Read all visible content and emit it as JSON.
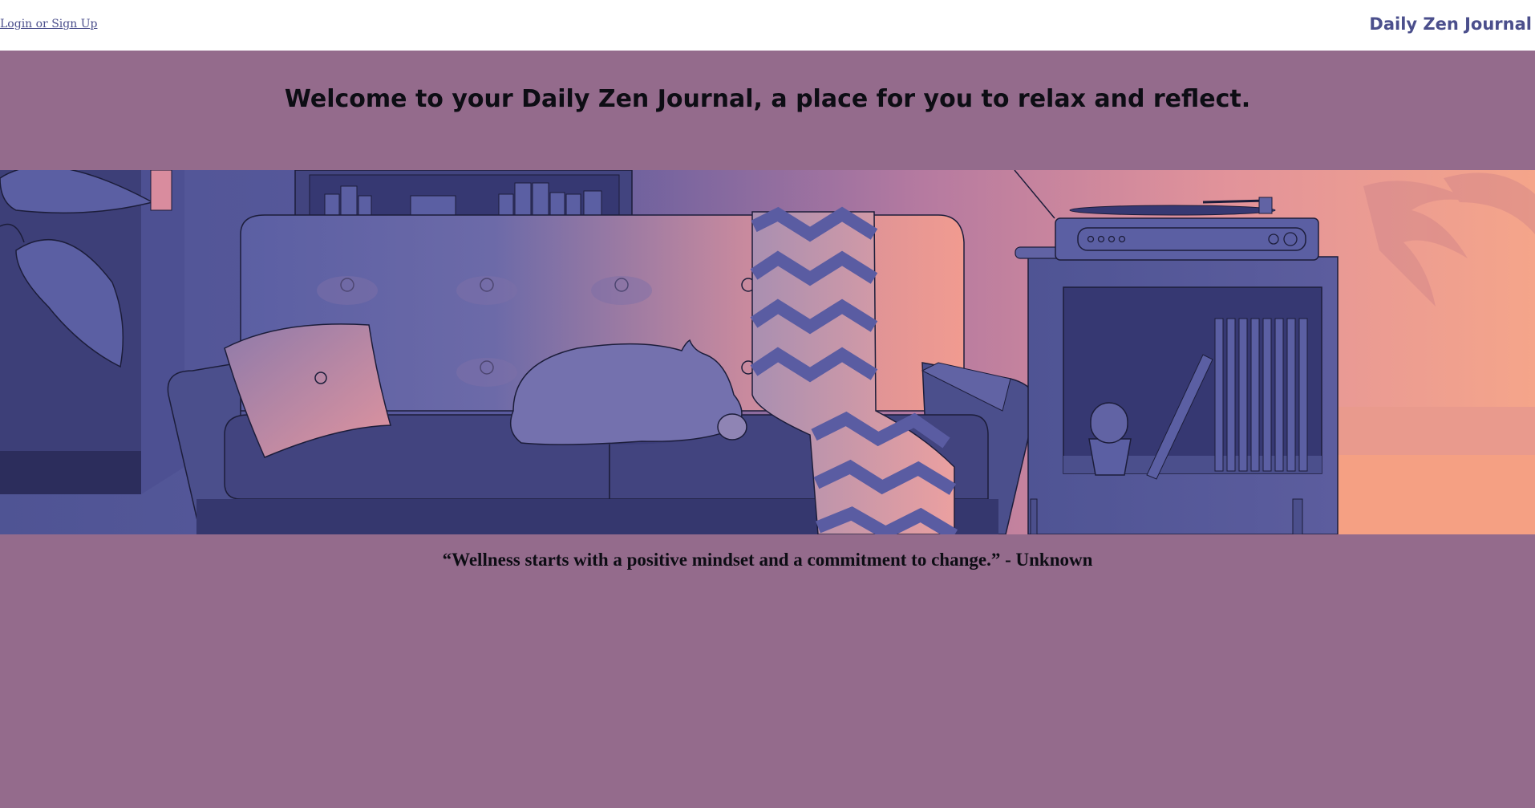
{
  "header": {
    "login_label": "Login or Sign Up",
    "brand": "Daily Zen Journal"
  },
  "main": {
    "welcome": "Welcome to your Daily Zen Journal, a place for you to relax and reflect.",
    "quote": "“Wellness starts with a positive mindset and a commitment to change.” - Unknown"
  },
  "colors": {
    "page_background": "#946b8c",
    "header_background": "#ffffff",
    "brand": "#4b4f8c",
    "heading_text": "#0d0d14"
  },
  "icons": {
    "hero": "cozy-living-room-illustration"
  }
}
